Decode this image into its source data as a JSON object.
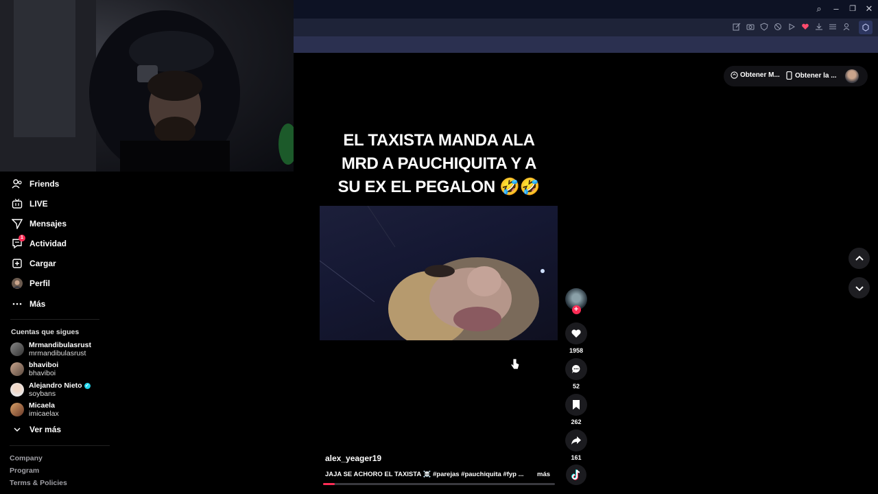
{
  "browser": {
    "window_controls": {
      "search": "⌕",
      "minimize": "–",
      "restore": "❐",
      "close": "✕"
    }
  },
  "sidebar": {
    "nav": [
      {
        "label": "Friends",
        "icon": "friends-icon"
      },
      {
        "label": "LIVE",
        "icon": "live-icon"
      },
      {
        "label": "Mensajes",
        "icon": "messages-icon"
      },
      {
        "label": "Actividad",
        "icon": "activity-icon",
        "badge": "1"
      },
      {
        "label": "Cargar",
        "icon": "upload-icon"
      },
      {
        "label": "Perfil",
        "icon": "profile-avatar"
      },
      {
        "label": "Más",
        "icon": "more-icon"
      }
    ],
    "following_title": "Cuentas que sigues",
    "following": [
      {
        "name": "Mrmandibulasrust",
        "handle": "mrmandibulasrust"
      },
      {
        "name": "bhaviboi",
        "handle": "bhaviboi"
      },
      {
        "name": "Alejandro Nieto",
        "handle": "soybans",
        "verified": true
      },
      {
        "name": "Micaela",
        "handle": "imicaelax"
      }
    ],
    "see_more": "Ver más",
    "footer": [
      "Company",
      "Program",
      "Terms & Policies"
    ]
  },
  "header": {
    "get_coins": "Obtener M...",
    "get_app": "Obtener la ..."
  },
  "video": {
    "caption_lines": [
      "EL TAXISTA MANDA ALA",
      "MRD A PAUCHIQUITA Y A",
      "SU EX EL PEGALON 🤣🤣"
    ],
    "author": "alex_yeager19",
    "description": "JAJA SE ACHORO EL TAXISTA ☠️ #parejas #pauchiquita #fyp ...",
    "more": "más",
    "progress": 0.05
  },
  "actions": {
    "likes": "1958",
    "comments": "52",
    "saves": "262",
    "shares": "161"
  },
  "colors": {
    "accent": "#fe2c55",
    "chrome_dark": "#0d1224",
    "tabstrip": "#1e2338",
    "urlbar": "#2b3050",
    "verified": "#20d5ec"
  }
}
